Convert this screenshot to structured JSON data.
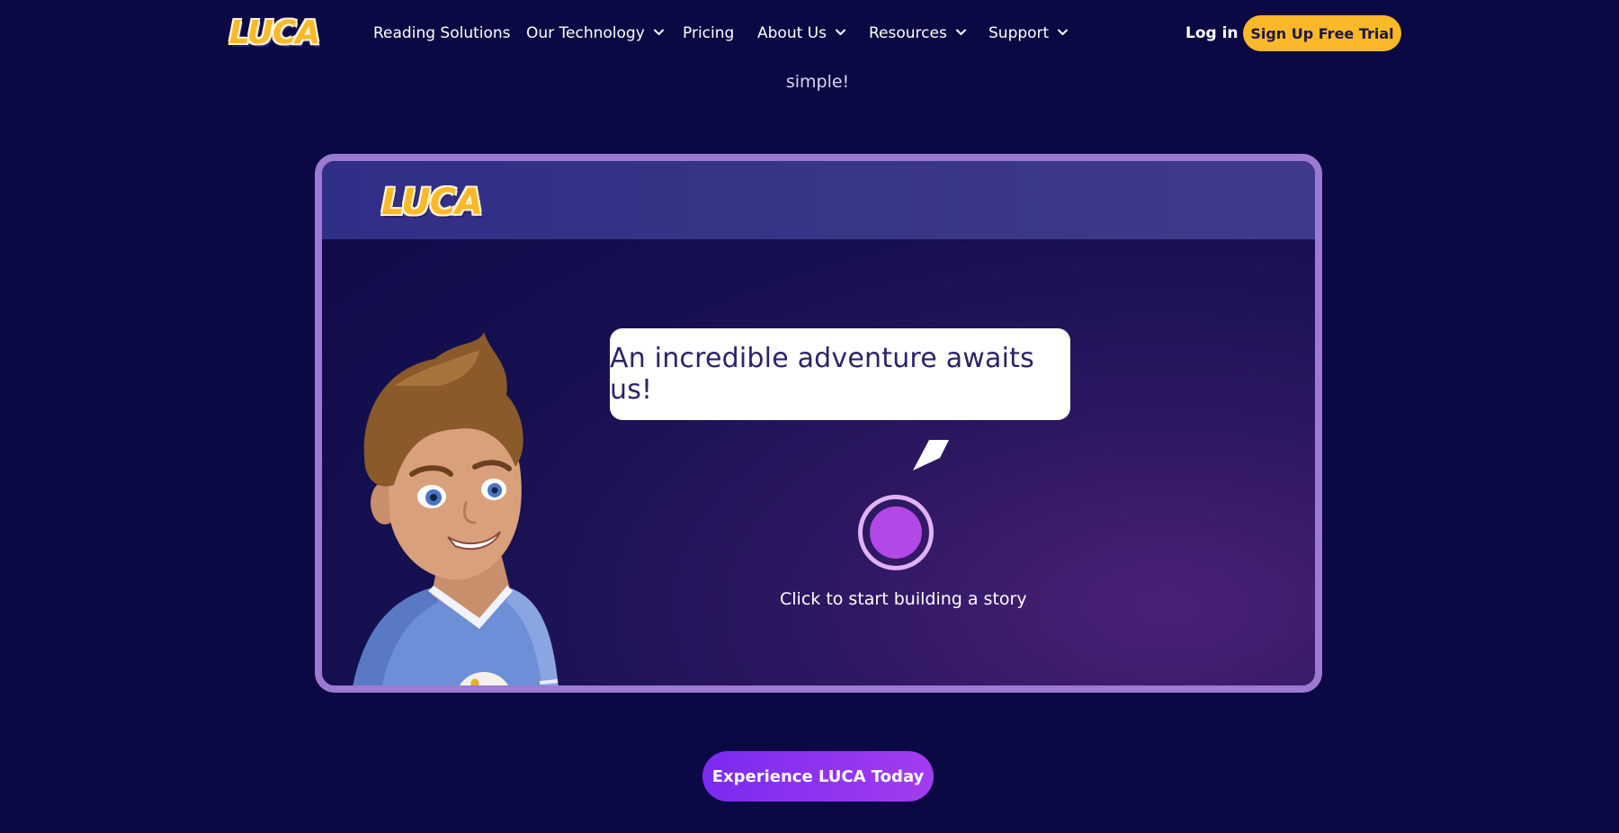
{
  "brand": {
    "logo_text": "LUCA",
    "accent_color": "#fbb829",
    "background_color": "#0b0944"
  },
  "nav": {
    "items": [
      {
        "label": "Reading Solutions",
        "has_dropdown": false
      },
      {
        "label": "Our Technology",
        "has_dropdown": true
      },
      {
        "label": "Pricing",
        "has_dropdown": false
      },
      {
        "label": "About Us",
        "has_dropdown": true
      },
      {
        "label": "Resources",
        "has_dropdown": true
      },
      {
        "label": "Support",
        "has_dropdown": true
      }
    ],
    "login_label": "Log in",
    "signup_label": "Sign Up Free Trial"
  },
  "intro": {
    "trailing_text": "simple!"
  },
  "demo": {
    "logo_text": "LUCA",
    "bubble_text": "An incredible adventure awaits us!",
    "record_label": "Click to start building a story",
    "record_icon": "record-button-icon",
    "character_icon": "boy-character-illustration"
  },
  "cta": {
    "label": "Experience LUCA Today"
  }
}
